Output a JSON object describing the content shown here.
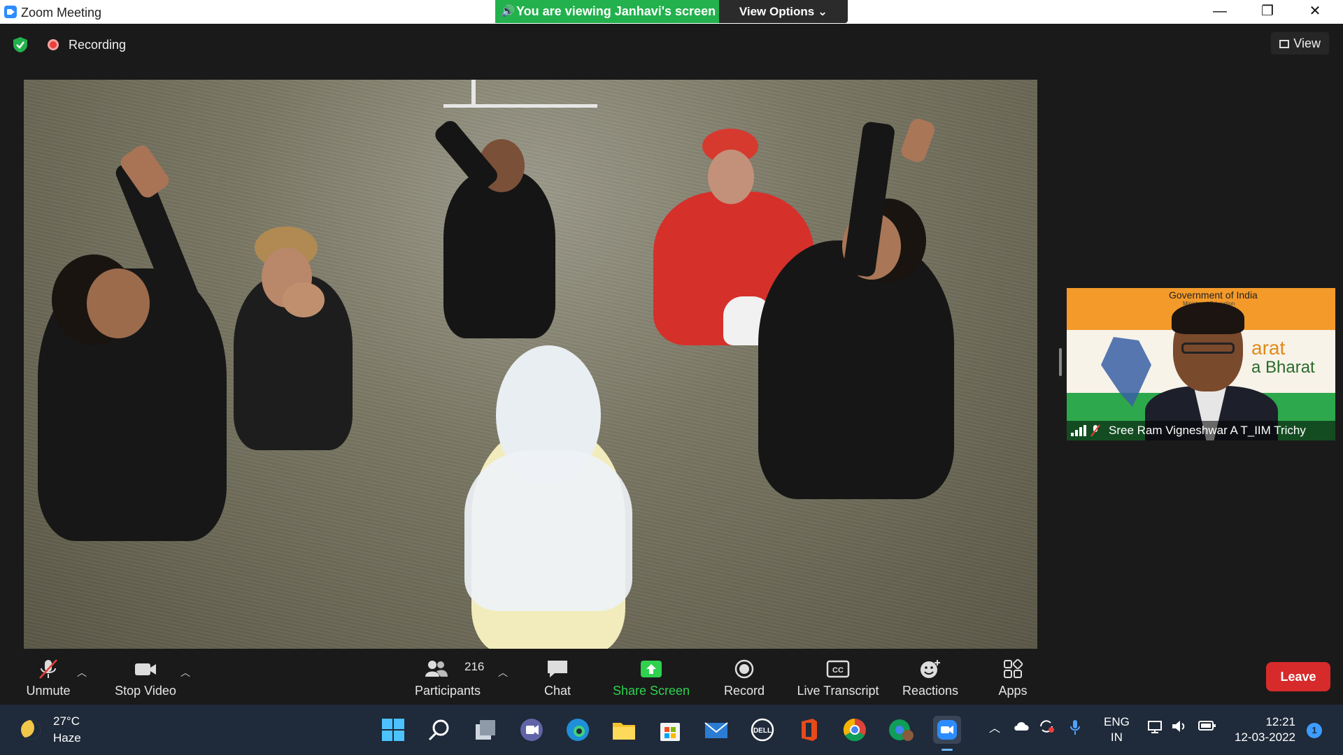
{
  "window": {
    "title": "Zoom Meeting",
    "viewing_banner": "You are viewing Janhavi's screen",
    "view_options": "View Options",
    "minimize": "—",
    "restore": "❐",
    "close": "✕"
  },
  "meeting_top": {
    "recording_label": "Recording",
    "view_label": "View"
  },
  "participant_tile": {
    "name": "Sree Ram Vigneshwar A T_IIM Trichy",
    "background_text_1": "Government of India",
    "background_text_2": "Ministry of Education",
    "background_text_3": "arat",
    "background_text_4": "a Bharat"
  },
  "controls": {
    "unmute": "Unmute",
    "stop_video": "Stop Video",
    "participants": "Participants",
    "participants_count": "216",
    "chat": "Chat",
    "share_screen": "Share Screen",
    "record": "Record",
    "live_transcript": "Live Transcript",
    "reactions": "Reactions",
    "apps": "Apps",
    "leave": "Leave"
  },
  "taskbar": {
    "temperature": "27°C",
    "weather": "Haze",
    "lang_1": "ENG",
    "lang_2": "IN",
    "time": "12:21",
    "date": "12-03-2022",
    "notifications": "1"
  },
  "colors": {
    "banner_green": "#23b14d",
    "leave_red": "#d72b2b",
    "share_green": "#2fd14f",
    "taskbar": "#1f2a3a"
  }
}
